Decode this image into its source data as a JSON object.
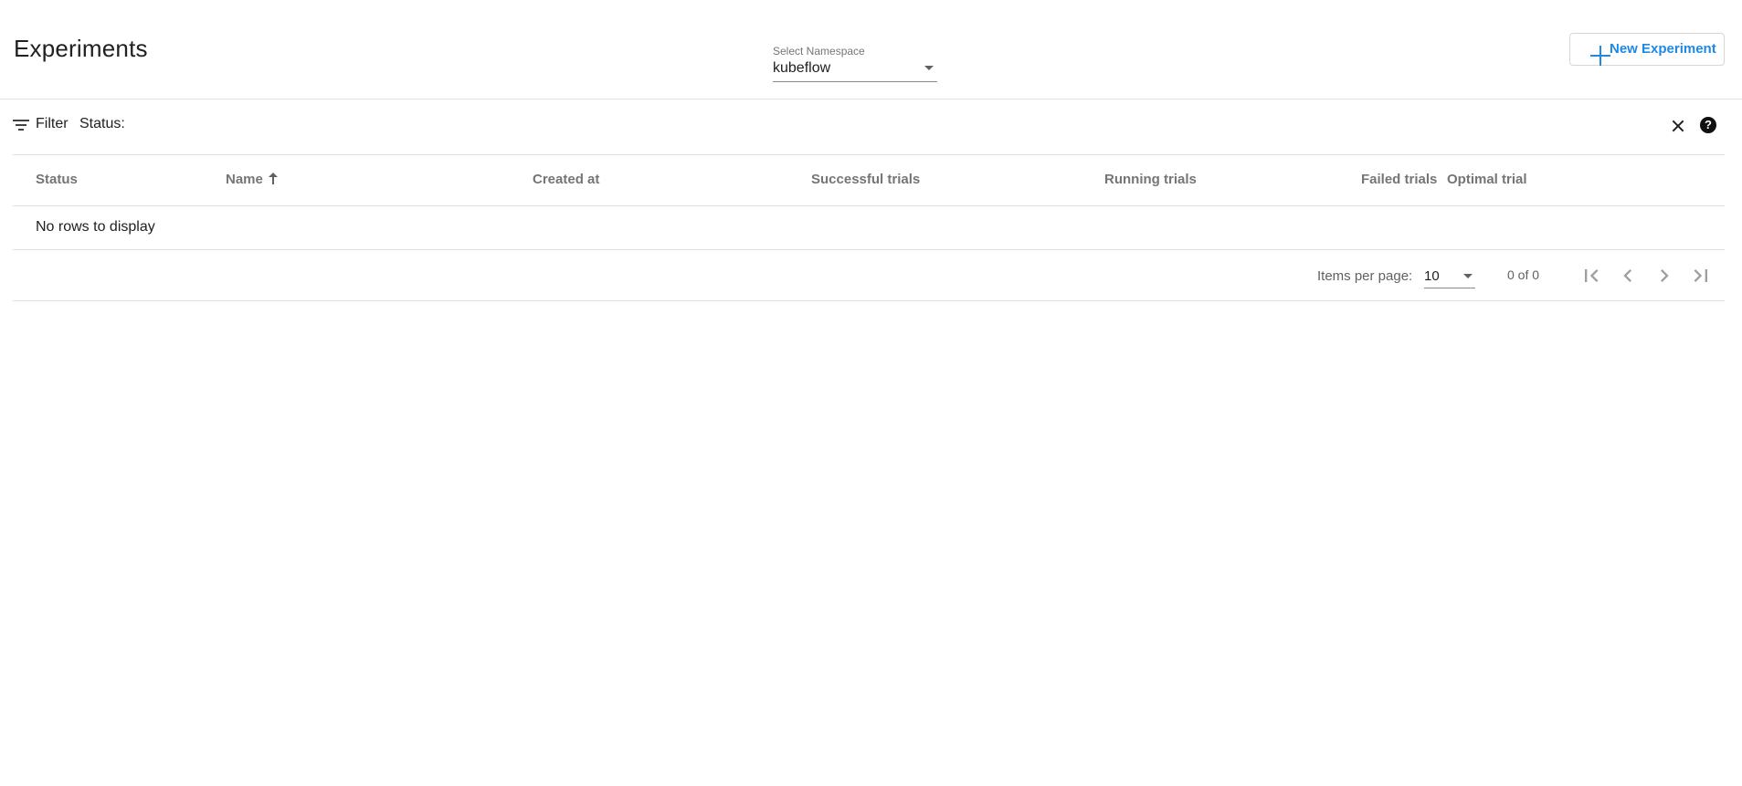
{
  "header": {
    "title": "Experiments",
    "namespace_label": "Select Namespace",
    "namespace_value": "kubeflow",
    "new_experiment_label": "New Experiment",
    "accent_color": "#1e88e5"
  },
  "filter_bar": {
    "filter_label": "Filter",
    "status_label": "Status:",
    "icons": [
      "filter-icon",
      "close-icon",
      "help-icon"
    ],
    "help_glyph": "?"
  },
  "table": {
    "columns": [
      {
        "label": "Status"
      },
      {
        "label": "Name"
      },
      {
        "label": "Created at"
      },
      {
        "label": "Successful trials"
      },
      {
        "label": "Running trials"
      },
      {
        "label": "Failed trials"
      },
      {
        "label": "Optimal trial"
      }
    ],
    "sorted_column": "Name",
    "sort_direction": "ascending",
    "rows": [],
    "empty_text": "No rows to display"
  },
  "paginator": {
    "items_per_page_label": "Items per page:",
    "items_per_page_value": "10",
    "range_label": "0 of 0",
    "icons": [
      "first-page-icon",
      "previous-page-icon",
      "next-page-icon",
      "last-page-icon"
    ]
  }
}
